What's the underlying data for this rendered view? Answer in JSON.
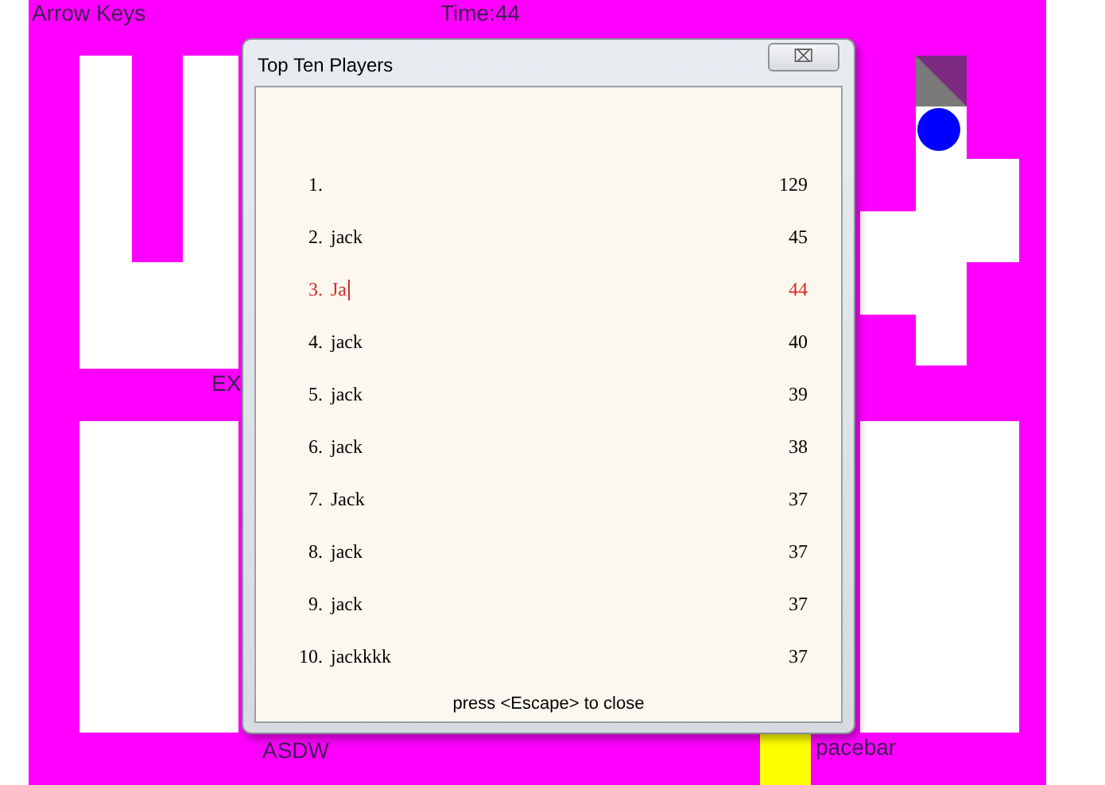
{
  "game": {
    "controls_label": "Arrow Keys",
    "timer": "Time:44",
    "exit_label": "EX",
    "keys_label": "ASDW",
    "action_label": "pacebar"
  },
  "dialog": {
    "title": "Top Ten Players",
    "close": "⌧",
    "footer": "press <Escape> to close",
    "rows": [
      {
        "rank": "1.",
        "score": "129",
        "current": false
      },
      {
        "rank": "2.",
        "name": "jack",
        "score": "45",
        "current": false
      },
      {
        "rank": "3.",
        "name": "Ja",
        "score": "44",
        "current": true
      },
      {
        "rank": "4.",
        "name": "jack",
        "score": "40",
        "current": false
      },
      {
        "rank": "5.",
        "name": "jack",
        "score": "39",
        "current": false
      },
      {
        "rank": "6.",
        "name": "jack",
        "score": "38",
        "current": false
      },
      {
        "rank": "7.",
        "name": "Jack",
        "score": "37",
        "current": false
      },
      {
        "rank": "8.",
        "name": "jack",
        "score": "37",
        "current": false
      },
      {
        "rank": "9.",
        "name": "jack",
        "score": "37",
        "current": false
      },
      {
        "rank": "10.",
        "name": "jackkkk",
        "score": "37",
        "current": false
      }
    ]
  }
}
